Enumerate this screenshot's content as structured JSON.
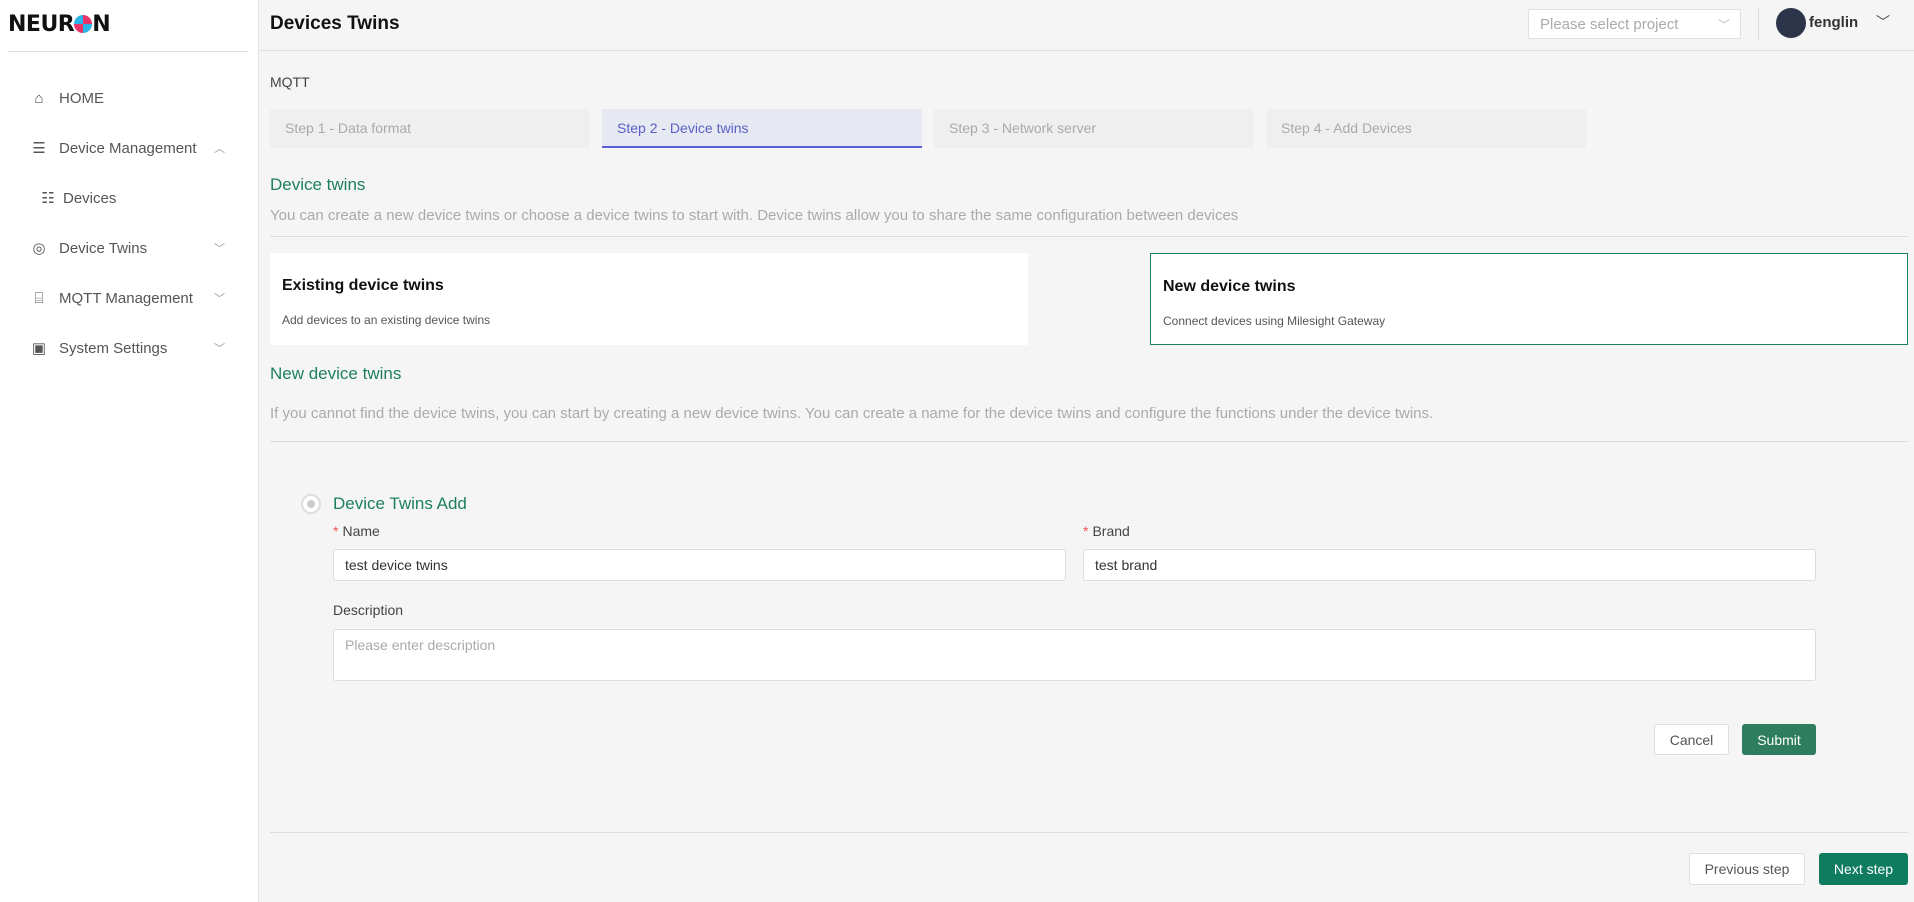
{
  "brand": {
    "logo_pre": "NEUR",
    "logo_post": "N"
  },
  "sidebar": {
    "items": [
      {
        "label": "HOME",
        "icon": "home-icon"
      },
      {
        "label": "Device Management",
        "icon": "server-icon",
        "expanded": true
      },
      {
        "label": "Devices",
        "icon": "devices-icon"
      },
      {
        "label": "Device Twins",
        "icon": "device-twins-icon"
      },
      {
        "label": "MQTT Management",
        "icon": "router-icon"
      },
      {
        "label": "System Settings",
        "icon": "monitor-icon"
      }
    ]
  },
  "header": {
    "title": "Devices Twins",
    "project_placeholder": "Please select project",
    "username": "fenglin"
  },
  "main": {
    "breadcrumb": "MQTT",
    "steps": [
      "Step 1 - Data format",
      "Step 2 - Device twins",
      "Step 3 - Network server",
      "Step 4 - Add Devices"
    ],
    "active_step": 2,
    "section1": {
      "title": "Device twins",
      "desc": "You can create a new device twins or choose a device twins to start with. Device twins allow you to share the same configuration between devices"
    },
    "cards": [
      {
        "title": "Existing device twins",
        "sub": "Add devices to an existing device twins",
        "selected": false
      },
      {
        "title": "New device twins",
        "sub": "Connect devices using Milesight Gateway",
        "selected": true
      }
    ],
    "section2": {
      "title": "New device twins",
      "desc": "If you cannot find the device twins, you can start by creating a new device twins. You can create a name for the device twins and configure the functions under the device twins."
    },
    "form": {
      "title": "Device Twins Add",
      "required_mark": "*",
      "name_label": "Name",
      "name_value": "test device twins",
      "brand_label": "Brand",
      "brand_value": "test brand",
      "description_label": "Description",
      "description_placeholder": "Please enter description",
      "cancel": "Cancel",
      "submit": "Submit"
    },
    "footer": {
      "previous": "Previous step",
      "next": "Next step"
    }
  },
  "colors": {
    "accent_green": "#2e7d5e",
    "step_active": "#5b5fc7"
  }
}
